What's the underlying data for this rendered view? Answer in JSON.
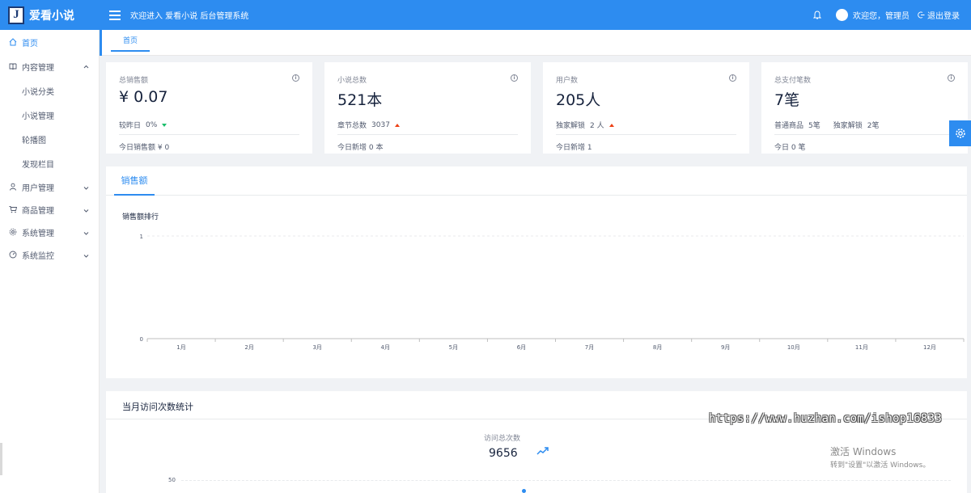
{
  "app": {
    "brand_letter": "J",
    "brand_name": "爱看小说",
    "welcome": "欢迎进入 爱看小说 后台管理系统",
    "greeting": "欢迎您，管理员",
    "logout": "退出登录",
    "accent_color": "#2d8cf0"
  },
  "sidebar": {
    "items": [
      {
        "label": "首页",
        "icon": "home-icon",
        "active": true
      },
      {
        "label": "内容管理",
        "icon": "book-icon",
        "expanded": true
      },
      {
        "label": "小说分类",
        "sub": true
      },
      {
        "label": "小说管理",
        "sub": true
      },
      {
        "label": "轮播图",
        "sub": true
      },
      {
        "label": "发现栏目",
        "sub": true
      },
      {
        "label": "用户管理",
        "icon": "user-icon"
      },
      {
        "label": "商品管理",
        "icon": "cart-icon"
      },
      {
        "label": "系统管理",
        "icon": "gear-icon"
      },
      {
        "label": "系统监控",
        "icon": "dashboard-icon"
      }
    ]
  },
  "tabs": {
    "home": "首页"
  },
  "cards": [
    {
      "label": "总销售额",
      "value": "¥ 0.07",
      "mid_label": "较昨日",
      "mid_value": "0%",
      "trend": "down",
      "foot": "今日销售额 ¥ 0"
    },
    {
      "label": "小说总数",
      "value": "521本",
      "mid_label": "章节总数",
      "mid_value": "3037",
      "trend": "up",
      "foot": "今日新增 0 本"
    },
    {
      "label": "用户数",
      "value": "205人",
      "mid_label": "独家解锁",
      "mid_value": "2 人",
      "trend": "up",
      "foot": "今日新增 1"
    },
    {
      "label": "总支付笔数",
      "value": "7笔",
      "mid_label": "普通商品",
      "mid_value": "5笔",
      "mid_label2": "独家解锁",
      "mid_value2": "2笔",
      "foot": "今日 0 笔"
    }
  ],
  "sales_panel": {
    "tab": "销售额",
    "chart_title": "销售额排行"
  },
  "chart_data": {
    "type": "bar",
    "title": "销售额排行",
    "categories": [
      "1月",
      "2月",
      "3月",
      "4月",
      "5月",
      "6月",
      "7月",
      "8月",
      "9月",
      "10月",
      "11月",
      "12月"
    ],
    "values": [
      0,
      0,
      0,
      0,
      0,
      0,
      0,
      0,
      0,
      0,
      0,
      0
    ],
    "y_ticks": [
      "0",
      "1"
    ],
    "ylim": [
      0,
      1
    ],
    "grid": true
  },
  "visit_panel": {
    "title": "当月访问次数统计",
    "total_label": "访问总次数",
    "total_value": "9656",
    "y_tick": "50"
  },
  "overlay": {
    "watermark": "https://www.huzhan.com/ishop16833",
    "activate_title": "激活 Windows",
    "activate_sub": "转到\"设置\"以激活 Windows。"
  }
}
